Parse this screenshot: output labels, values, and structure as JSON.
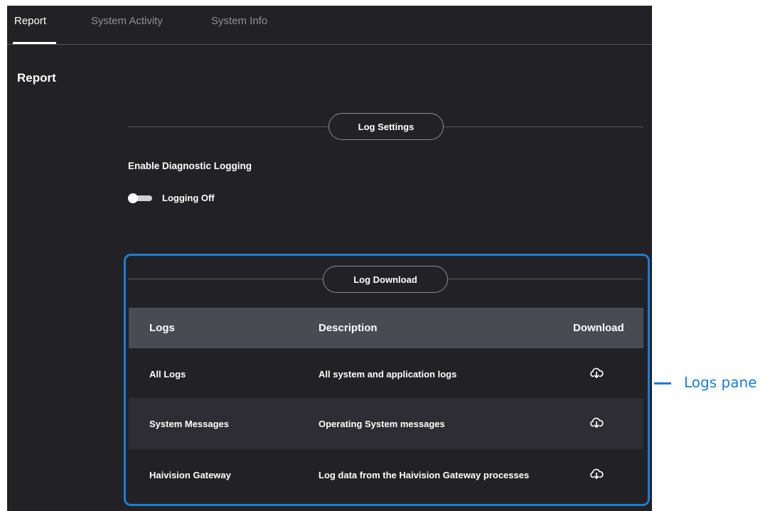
{
  "tabs": [
    {
      "label": "Report",
      "active": true
    },
    {
      "label": "System Activity",
      "active": false
    },
    {
      "label": "System Info",
      "active": false
    }
  ],
  "page": {
    "title": "Report"
  },
  "log_settings": {
    "section_label": "Log Settings",
    "field_label": "Enable Diagnostic Logging",
    "toggle_label": "Logging Off",
    "toggle_on": false
  },
  "log_download": {
    "section_label": "Log Download",
    "columns": [
      "Logs",
      "Description",
      "Download"
    ],
    "rows": [
      {
        "log": "All Logs",
        "description": "All system and application logs",
        "icon": "cloud-download-icon"
      },
      {
        "log": "System Messages",
        "description": "Operating System messages",
        "icon": "cloud-download-icon"
      },
      {
        "log": "Haivision Gateway",
        "description": "Log data from the Haivision Gateway processes",
        "icon": "cloud-download-icon"
      }
    ]
  },
  "annotation": {
    "label": "Logs pane",
    "color": "#1a7fd4"
  },
  "colors": {
    "background": "#222226",
    "header_row": "#4a4a52",
    "alt_row": "#2d2d33"
  }
}
